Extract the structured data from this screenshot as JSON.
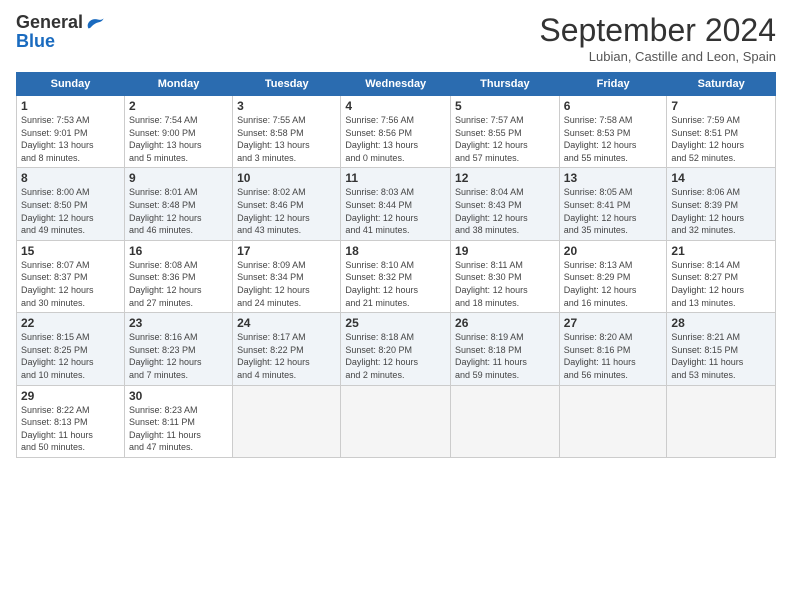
{
  "logo": {
    "general": "General",
    "blue": "Blue"
  },
  "title": "September 2024",
  "subtitle": "Lubian, Castille and Leon, Spain",
  "days_header": [
    "Sunday",
    "Monday",
    "Tuesday",
    "Wednesday",
    "Thursday",
    "Friday",
    "Saturday"
  ],
  "weeks": [
    [
      {
        "day": "1",
        "info": "Sunrise: 7:53 AM\nSunset: 9:01 PM\nDaylight: 13 hours\nand 8 minutes."
      },
      {
        "day": "2",
        "info": "Sunrise: 7:54 AM\nSunset: 9:00 PM\nDaylight: 13 hours\nand 5 minutes."
      },
      {
        "day": "3",
        "info": "Sunrise: 7:55 AM\nSunset: 8:58 PM\nDaylight: 13 hours\nand 3 minutes."
      },
      {
        "day": "4",
        "info": "Sunrise: 7:56 AM\nSunset: 8:56 PM\nDaylight: 13 hours\nand 0 minutes."
      },
      {
        "day": "5",
        "info": "Sunrise: 7:57 AM\nSunset: 8:55 PM\nDaylight: 12 hours\nand 57 minutes."
      },
      {
        "day": "6",
        "info": "Sunrise: 7:58 AM\nSunset: 8:53 PM\nDaylight: 12 hours\nand 55 minutes."
      },
      {
        "day": "7",
        "info": "Sunrise: 7:59 AM\nSunset: 8:51 PM\nDaylight: 12 hours\nand 52 minutes."
      }
    ],
    [
      {
        "day": "8",
        "info": "Sunrise: 8:00 AM\nSunset: 8:50 PM\nDaylight: 12 hours\nand 49 minutes."
      },
      {
        "day": "9",
        "info": "Sunrise: 8:01 AM\nSunset: 8:48 PM\nDaylight: 12 hours\nand 46 minutes."
      },
      {
        "day": "10",
        "info": "Sunrise: 8:02 AM\nSunset: 8:46 PM\nDaylight: 12 hours\nand 43 minutes."
      },
      {
        "day": "11",
        "info": "Sunrise: 8:03 AM\nSunset: 8:44 PM\nDaylight: 12 hours\nand 41 minutes."
      },
      {
        "day": "12",
        "info": "Sunrise: 8:04 AM\nSunset: 8:43 PM\nDaylight: 12 hours\nand 38 minutes."
      },
      {
        "day": "13",
        "info": "Sunrise: 8:05 AM\nSunset: 8:41 PM\nDaylight: 12 hours\nand 35 minutes."
      },
      {
        "day": "14",
        "info": "Sunrise: 8:06 AM\nSunset: 8:39 PM\nDaylight: 12 hours\nand 32 minutes."
      }
    ],
    [
      {
        "day": "15",
        "info": "Sunrise: 8:07 AM\nSunset: 8:37 PM\nDaylight: 12 hours\nand 30 minutes."
      },
      {
        "day": "16",
        "info": "Sunrise: 8:08 AM\nSunset: 8:36 PM\nDaylight: 12 hours\nand 27 minutes."
      },
      {
        "day": "17",
        "info": "Sunrise: 8:09 AM\nSunset: 8:34 PM\nDaylight: 12 hours\nand 24 minutes."
      },
      {
        "day": "18",
        "info": "Sunrise: 8:10 AM\nSunset: 8:32 PM\nDaylight: 12 hours\nand 21 minutes."
      },
      {
        "day": "19",
        "info": "Sunrise: 8:11 AM\nSunset: 8:30 PM\nDaylight: 12 hours\nand 18 minutes."
      },
      {
        "day": "20",
        "info": "Sunrise: 8:13 AM\nSunset: 8:29 PM\nDaylight: 12 hours\nand 16 minutes."
      },
      {
        "day": "21",
        "info": "Sunrise: 8:14 AM\nSunset: 8:27 PM\nDaylight: 12 hours\nand 13 minutes."
      }
    ],
    [
      {
        "day": "22",
        "info": "Sunrise: 8:15 AM\nSunset: 8:25 PM\nDaylight: 12 hours\nand 10 minutes."
      },
      {
        "day": "23",
        "info": "Sunrise: 8:16 AM\nSunset: 8:23 PM\nDaylight: 12 hours\nand 7 minutes."
      },
      {
        "day": "24",
        "info": "Sunrise: 8:17 AM\nSunset: 8:22 PM\nDaylight: 12 hours\nand 4 minutes."
      },
      {
        "day": "25",
        "info": "Sunrise: 8:18 AM\nSunset: 8:20 PM\nDaylight: 12 hours\nand 2 minutes."
      },
      {
        "day": "26",
        "info": "Sunrise: 8:19 AM\nSunset: 8:18 PM\nDaylight: 11 hours\nand 59 minutes."
      },
      {
        "day": "27",
        "info": "Sunrise: 8:20 AM\nSunset: 8:16 PM\nDaylight: 11 hours\nand 56 minutes."
      },
      {
        "day": "28",
        "info": "Sunrise: 8:21 AM\nSunset: 8:15 PM\nDaylight: 11 hours\nand 53 minutes."
      }
    ],
    [
      {
        "day": "29",
        "info": "Sunrise: 8:22 AM\nSunset: 8:13 PM\nDaylight: 11 hours\nand 50 minutes."
      },
      {
        "day": "30",
        "info": "Sunrise: 8:23 AM\nSunset: 8:11 PM\nDaylight: 11 hours\nand 47 minutes."
      },
      null,
      null,
      null,
      null,
      null
    ]
  ]
}
